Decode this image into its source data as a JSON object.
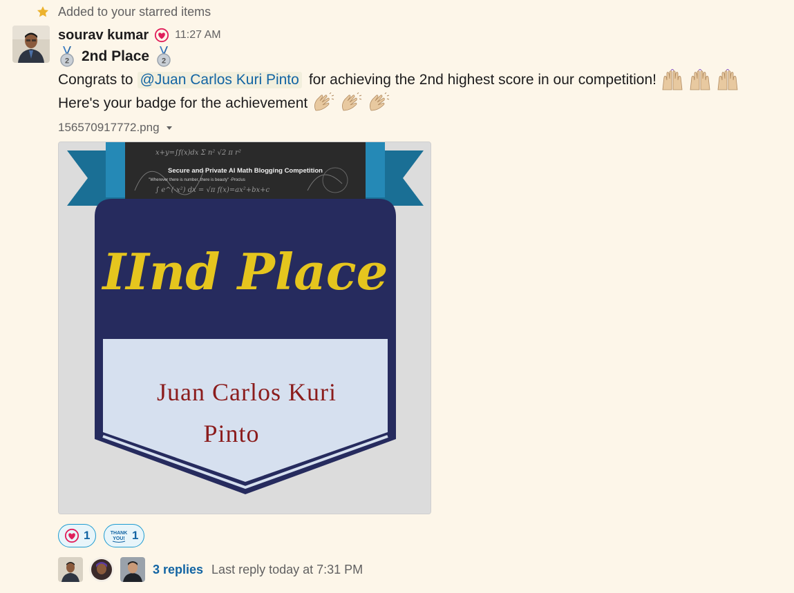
{
  "banner": {
    "text": "Added to your starred items",
    "icon": "star-icon"
  },
  "message": {
    "author": "sourav kumar",
    "status_icon": "heart-badge-icon",
    "time": "11:27 AM",
    "title": "2nd Place",
    "congrats_prefix": "Congrats to",
    "mention": "@Juan Carlos Kuri Pinto",
    "congrats_suffix": "for achieving the 2nd highest score in our competition!",
    "badge_text": "Here's your badge for the achievement",
    "file_name": "156570917772.png"
  },
  "badge_image": {
    "header_text": "Secure and Private AI Math Blogging Competition",
    "header_quote": "\"Wherever there is number, there is beauty\" -Proclus",
    "place_text": "IInd Place",
    "winner_line1": "Juan Carlos Kuri",
    "winner_line2": "Pinto"
  },
  "reactions": [
    {
      "icon": "heart-badge-icon",
      "count": "1"
    },
    {
      "icon": "thank-you-icon",
      "count": "1"
    }
  ],
  "thread": {
    "replies": "3 replies",
    "last_reply": "Last reply today at 7:31 PM"
  },
  "colors": {
    "background": "#fdf6e9",
    "link": "#1264a3",
    "badge_navy": "#262b5e",
    "badge_gold": "#e5c51e",
    "ribbon_blue": "#1f7fa8",
    "name_red": "#8b1c1c"
  }
}
